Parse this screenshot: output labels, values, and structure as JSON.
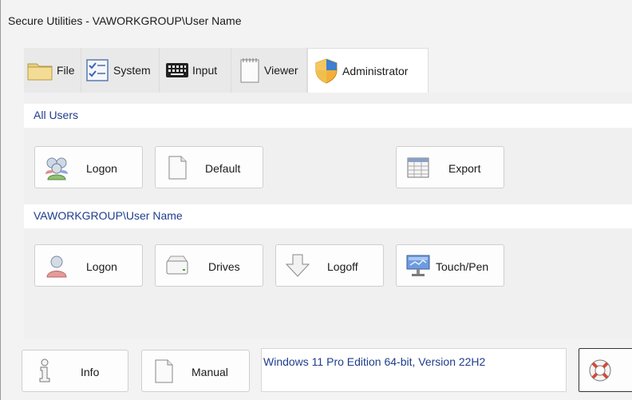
{
  "window": {
    "title": "Secure Utilities - VAWORKGROUP\\User Name"
  },
  "tabs": [
    {
      "label": "File",
      "icon": "folder-icon"
    },
    {
      "label": "System",
      "icon": "checklist-icon"
    },
    {
      "label": "Input",
      "icon": "keyboard-icon"
    },
    {
      "label": "Viewer",
      "icon": "notepad-icon"
    },
    {
      "label": "Administrator",
      "icon": "shield-icon",
      "active": true
    }
  ],
  "all_users": {
    "header": "All Users",
    "buttons": [
      {
        "label": "Logon",
        "icon": "users-group-icon"
      },
      {
        "label": "Default",
        "icon": "blank-document-icon"
      },
      {
        "label": "Export",
        "icon": "table-icon"
      }
    ]
  },
  "current_user": {
    "header": "VAWORKGROUP\\User Name",
    "buttons": [
      {
        "label": "Logon",
        "icon": "user-icon"
      },
      {
        "label": "Drives",
        "icon": "drive-icon"
      },
      {
        "label": "Logoff",
        "icon": "down-arrow-icon"
      },
      {
        "label": "Touch/Pen",
        "icon": "touch-screen-icon"
      }
    ]
  },
  "bottom": {
    "info_label": "Info",
    "manual_label": "Manual",
    "os_info": "Windows 11 Pro Edition 64-bit, Version 22H2",
    "help_icon": "lifebuoy-icon"
  },
  "colors": {
    "accent_text": "#1f3d8c",
    "panel_bg": "#f0f0f0"
  }
}
